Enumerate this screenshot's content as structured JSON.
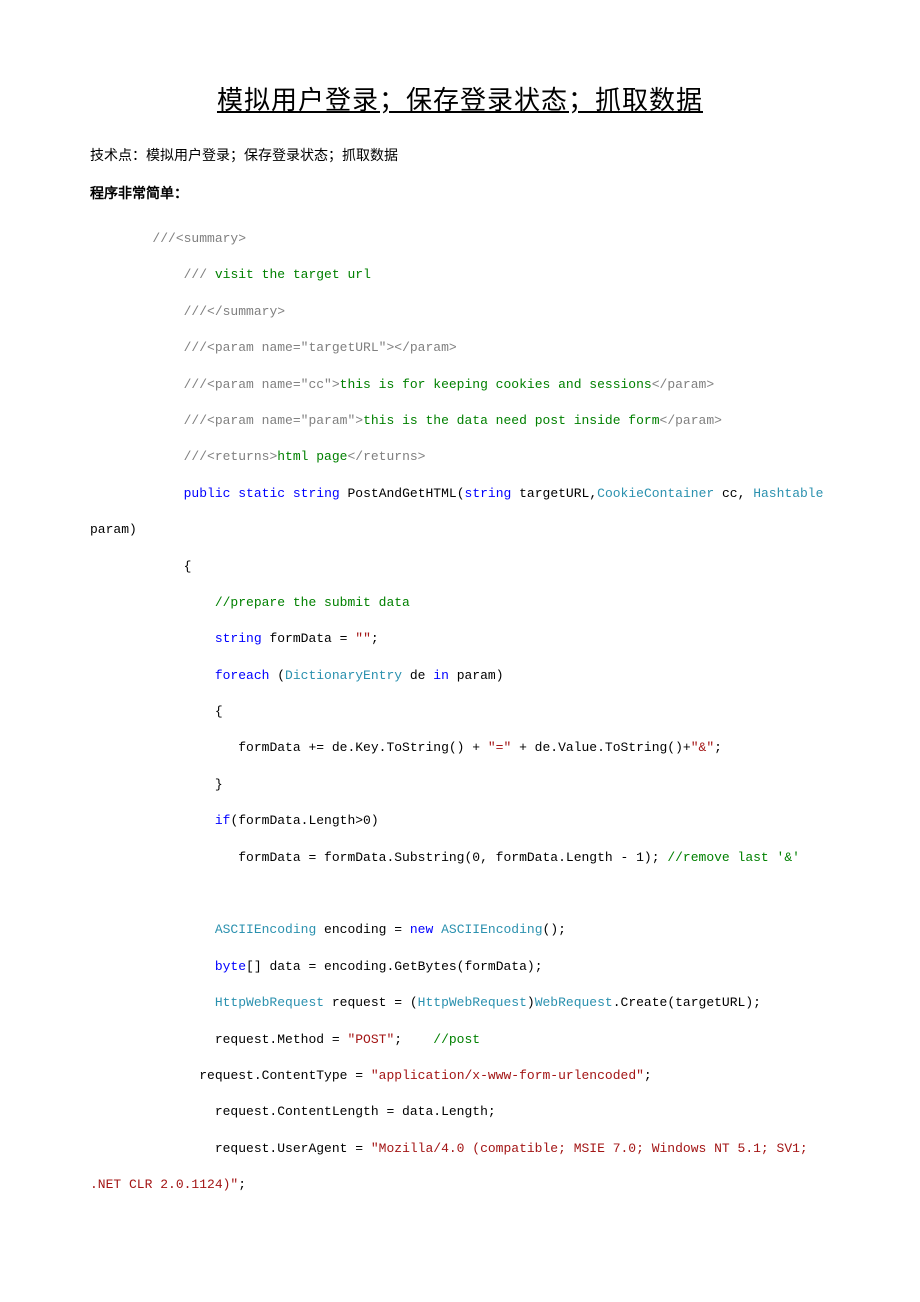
{
  "title": "模拟用户登录；保存登录状态；抓取数据",
  "intro": "技术点：模拟用户登录；保存登录状态；抓取数据",
  "note": "程序非常简单：",
  "code": {
    "s1": "///",
    "s1b": "<summary>",
    "s2": "/// ",
    "s2b": "visit the target url",
    "s3": "///",
    "s3b": "</summary>",
    "s4": "///",
    "s4b": "<param name=\"targetURL\"></param>",
    "s5": "///",
    "s5b": "<param name=\"cc\">",
    "s5c": "this is for keeping cookies and sessions",
    "s5d": "</param>",
    "s6": "///",
    "s6b": "<param name=\"param\">",
    "s6c": "this is the data need post inside form",
    "s6d": "</param>",
    "s7": "///",
    "s7b": "<returns>",
    "s7c": "html page",
    "s7d": "</returns>",
    "kw_public": "public",
    "kw_static": "static",
    "kw_string": "string",
    "method": " PostAndGetHTML(",
    "p1": " targetURL,",
    "type_cc": "CookieContainer",
    "p2": " cc, ",
    "type_hash": "Hashtable",
    "p3": " param)",
    "brace_open": "{",
    "c1": "//prepare the submit data",
    "l1a": " formData = ",
    "str_empty": "\"\"",
    "semi": ";",
    "kw_foreach": "foreach",
    "l2a": " (",
    "type_de": "DictionaryEntry",
    "l2b": " de ",
    "kw_in": "in",
    "l2c": " param)",
    "l3": "formData += de.Key.ToString() + ",
    "str_eq": "\"=\"",
    "l3b": " + de.Value.ToString()+",
    "str_amp": "\"&\"",
    "brace_close": "}",
    "kw_if": "if",
    "l4a": "(formData.Length>0)",
    "l5": "formData = formData.Substring(0, formData.Length - 1); ",
    "c2": "//remove last '&'",
    "type_ascii": "ASCIIEncoding",
    "l6a": " encoding = ",
    "kw_new": "new",
    "l6b": " ",
    "l6c": "();",
    "kw_byte": "byte",
    "l7a": "[] data = encoding.GetBytes(formData);",
    "type_hwr": "HttpWebRequest",
    "l8a": " request = (",
    "l8b": ")",
    "type_wr": "WebRequest",
    "l8c": ".Create(targetURL);",
    "l9a": "request.Method = ",
    "str_post": "\"POST\"",
    "l9b": ";    ",
    "c3": "//post",
    "l10a": "request.ContentType = ",
    "str_ct": "\"application/x-www-form-urlencoded\"",
    "l11": "request.ContentLength = data.Length;",
    "l12a": "request.UserAgent = ",
    "str_ua": "\"Mozilla/4.0 (compatible; MSIE 7.0; Windows NT 5.1; SV1; .NET CLR 2.0.1124)\"",
    "sp8": "        ",
    "sp12": "            ",
    "sp16": "                ",
    "sp10": "          "
  }
}
